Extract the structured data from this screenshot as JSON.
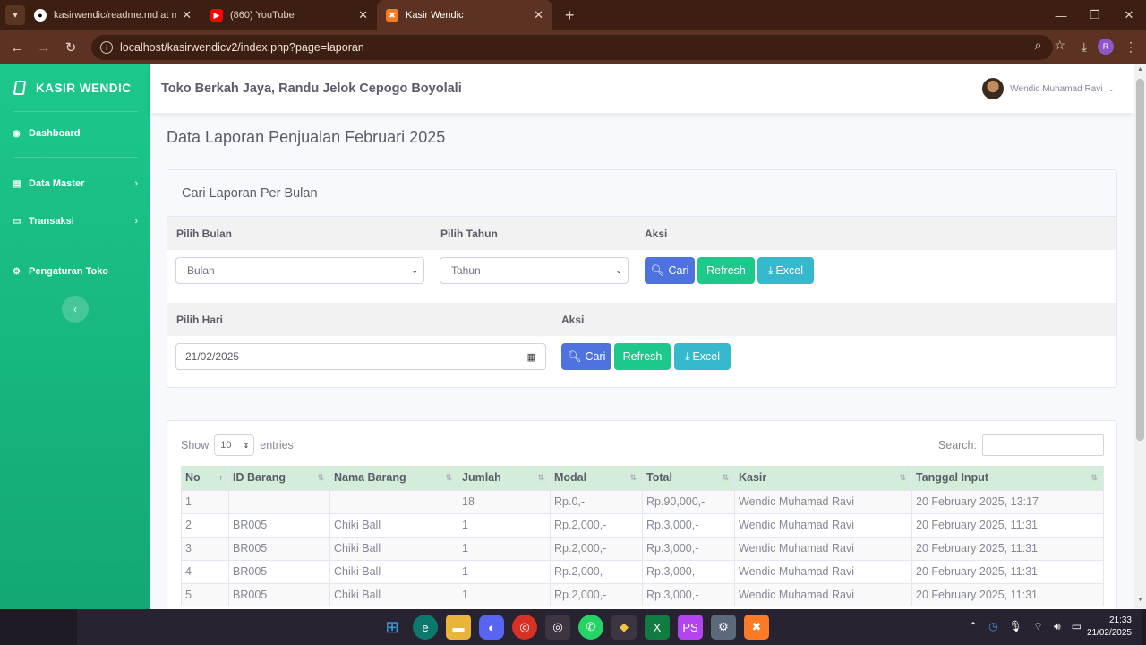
{
  "browser": {
    "tabs": [
      {
        "title": "kasirwendic/readme.md at main",
        "icon": "github-icon",
        "active": false
      },
      {
        "title": "(860) YouTube",
        "icon": "youtube-icon",
        "active": false
      },
      {
        "title": "Kasir Wendic",
        "icon": "xampp-icon",
        "active": true
      }
    ],
    "url": "localhost/kasirwendicv2/index.php?page=laporan",
    "profile_initial": "R"
  },
  "sidebar": {
    "brand": "KASIR WENDIC",
    "items": [
      {
        "label": "Dashboard",
        "icon": "tachometer-icon",
        "has_submenu": false
      },
      {
        "label": "Data Master",
        "icon": "database-icon",
        "has_submenu": true
      },
      {
        "label": "Transaksi",
        "icon": "desktop-icon",
        "has_submenu": true
      },
      {
        "label": "Pengaturan Toko",
        "icon": "cogs-icon",
        "has_submenu": false
      }
    ]
  },
  "topbar": {
    "store_name": "Toko Berkah Jaya, Randu Jelok Cepogo Boyolali",
    "user_name": "Wendic Muhamad Ravi"
  },
  "page": {
    "title": "Data Laporan Penjualan Februari 2025"
  },
  "filter_card": {
    "title": "Cari Laporan Per Bulan",
    "month_row": {
      "col_month": "Pilih Bulan",
      "col_year": "Pilih Tahun",
      "col_action": "Aksi",
      "month_value": "Bulan",
      "year_value": "Tahun",
      "btn_search": "Cari",
      "btn_refresh": "Refresh",
      "btn_excel": "Excel"
    },
    "day_row": {
      "col_day": "Pilih Hari",
      "col_action": "Aksi",
      "date_value": "21/02/2025",
      "btn_search": "Cari",
      "btn_refresh": "Refresh",
      "btn_excel": "Excel"
    }
  },
  "table": {
    "show_label": "Show",
    "length_value": "10",
    "entries_label": "entries",
    "search_label": "Search:",
    "columns": [
      "No",
      "ID Barang",
      "Nama Barang",
      "Jumlah",
      "Modal",
      "Total",
      "Kasir",
      "Tanggal Input"
    ],
    "rows": [
      [
        "1",
        "",
        "",
        "18",
        "Rp.0,-",
        "Rp.90,000,-",
        "Wendic Muhamad Ravi",
        "20 February 2025, 13:17"
      ],
      [
        "2",
        "BR005",
        "Chiki Ball",
        "1",
        "Rp.2,000,-",
        "Rp.3,000,-",
        "Wendic Muhamad Ravi",
        "20 February 2025, 11:31"
      ],
      [
        "3",
        "BR005",
        "Chiki Ball",
        "1",
        "Rp.2,000,-",
        "Rp.3,000,-",
        "Wendic Muhamad Ravi",
        "20 February 2025, 11:31"
      ],
      [
        "4",
        "BR005",
        "Chiki Ball",
        "1",
        "Rp.2,000,-",
        "Rp.3,000,-",
        "Wendic Muhamad Ravi",
        "20 February 2025, 11:31"
      ],
      [
        "5",
        "BR005",
        "Chiki Ball",
        "1",
        "Rp.2,000,-",
        "Rp.3,000,-",
        "Wendic Muhamad Ravi",
        "20 February 2025, 11:31"
      ]
    ]
  },
  "taskbar": {
    "time": "21:33",
    "date": "21/02/2025"
  }
}
